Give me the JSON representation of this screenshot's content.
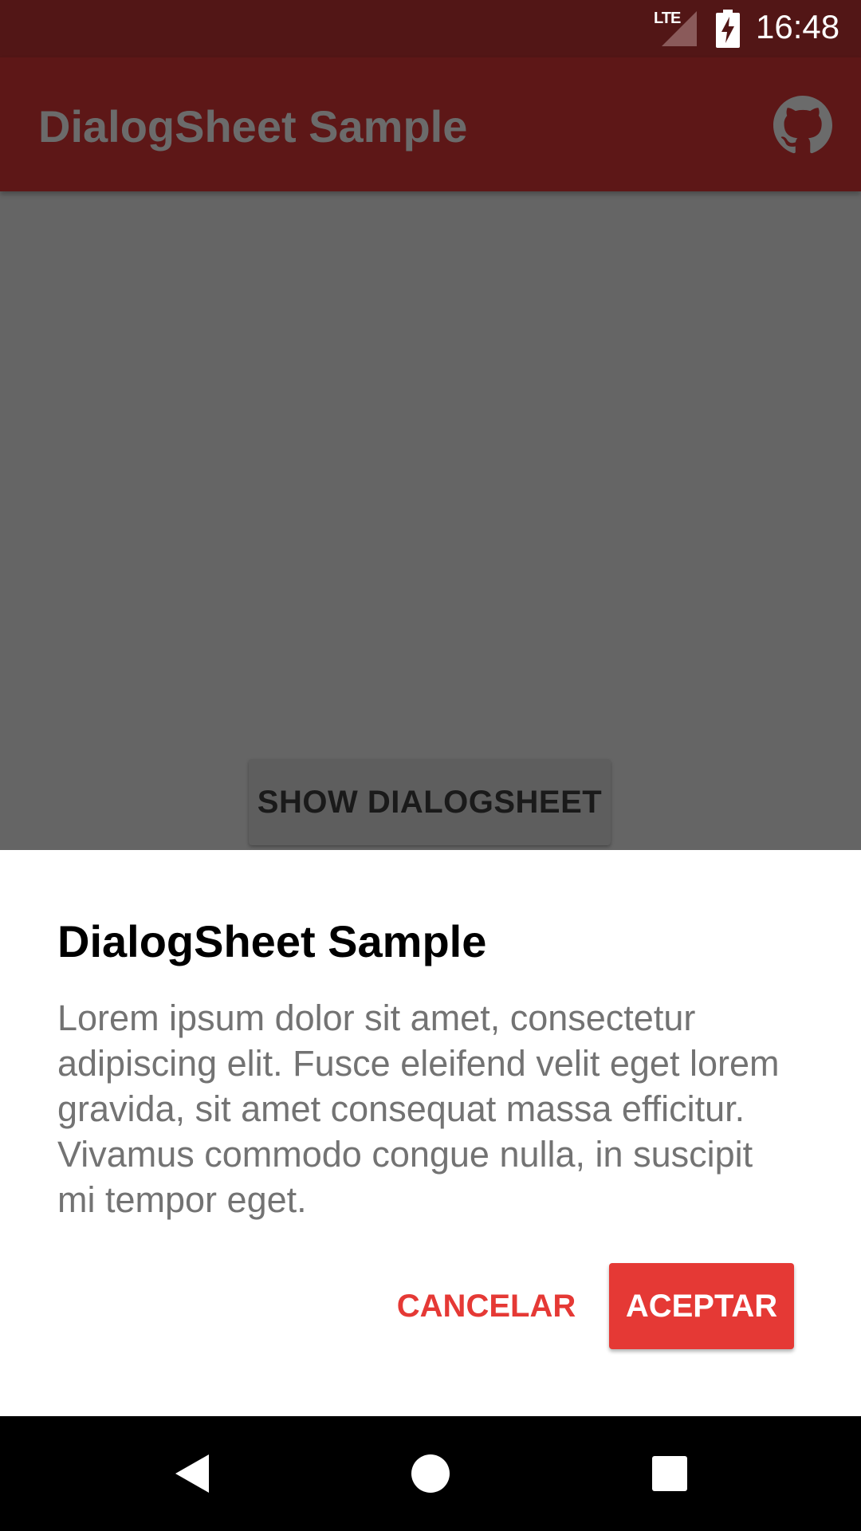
{
  "status_bar": {
    "network": "LTE",
    "time": "16:48"
  },
  "app_bar": {
    "title": "DialogSheet Sample",
    "action_icon": "github-icon"
  },
  "content": {
    "show_button_label": "SHOW DIALOGSHEET"
  },
  "dialog": {
    "title": "DialogSheet Sample",
    "message": "Lorem ipsum dolor sit amet, consectetur adipiscing elit. Fusce eleifend velit eget lorem gravida, sit amet consequat massa efficitur. Vivamus commodo congue nulla, in suscipit mi tempor eget.",
    "negative_label": "CANCELAR",
    "positive_label": "ACEPTAR"
  },
  "nav_bar": {
    "back_icon": "back-icon",
    "home_icon": "home-icon",
    "recents_icon": "recents-icon"
  },
  "colors": {
    "accent": "#e53935",
    "primary_dark": "#521616",
    "primary": "#5d1717",
    "scrim_background": "#656565"
  }
}
